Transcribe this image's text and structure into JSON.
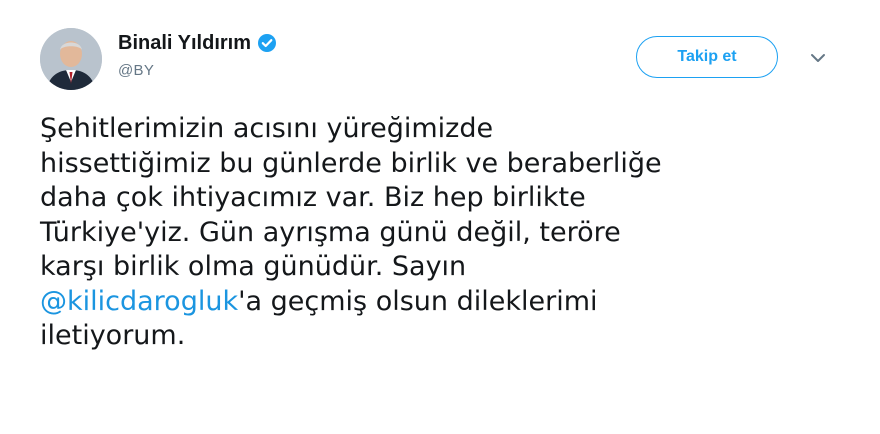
{
  "author": {
    "name": "Binali Yıldırım",
    "handle": "@BY",
    "verified": true
  },
  "actions": {
    "follow_label": "Takip et",
    "more_icon": "chevron-down-icon"
  },
  "tweet": {
    "lines": [
      "Şehitlerimizin acısını yüreğimizde",
      "hissettiğimiz bu günlerde birlik ve beraberliğe",
      "daha çok ihtiyacımız var. Biz hep birlikte",
      "Türkiye'yiz. Gün ayrışma günü değil, teröre",
      "karşı birlik olma günüdür. Sayın"
    ],
    "mention": "@kilicdarogluk",
    "after_mention": "'a geçmiş olsun dileklerimi",
    "last_line": "iletiyorum."
  },
  "colors": {
    "accent": "#1da1f2",
    "mention": "#1b95e0",
    "text": "#14171a",
    "muted": "#657786"
  }
}
